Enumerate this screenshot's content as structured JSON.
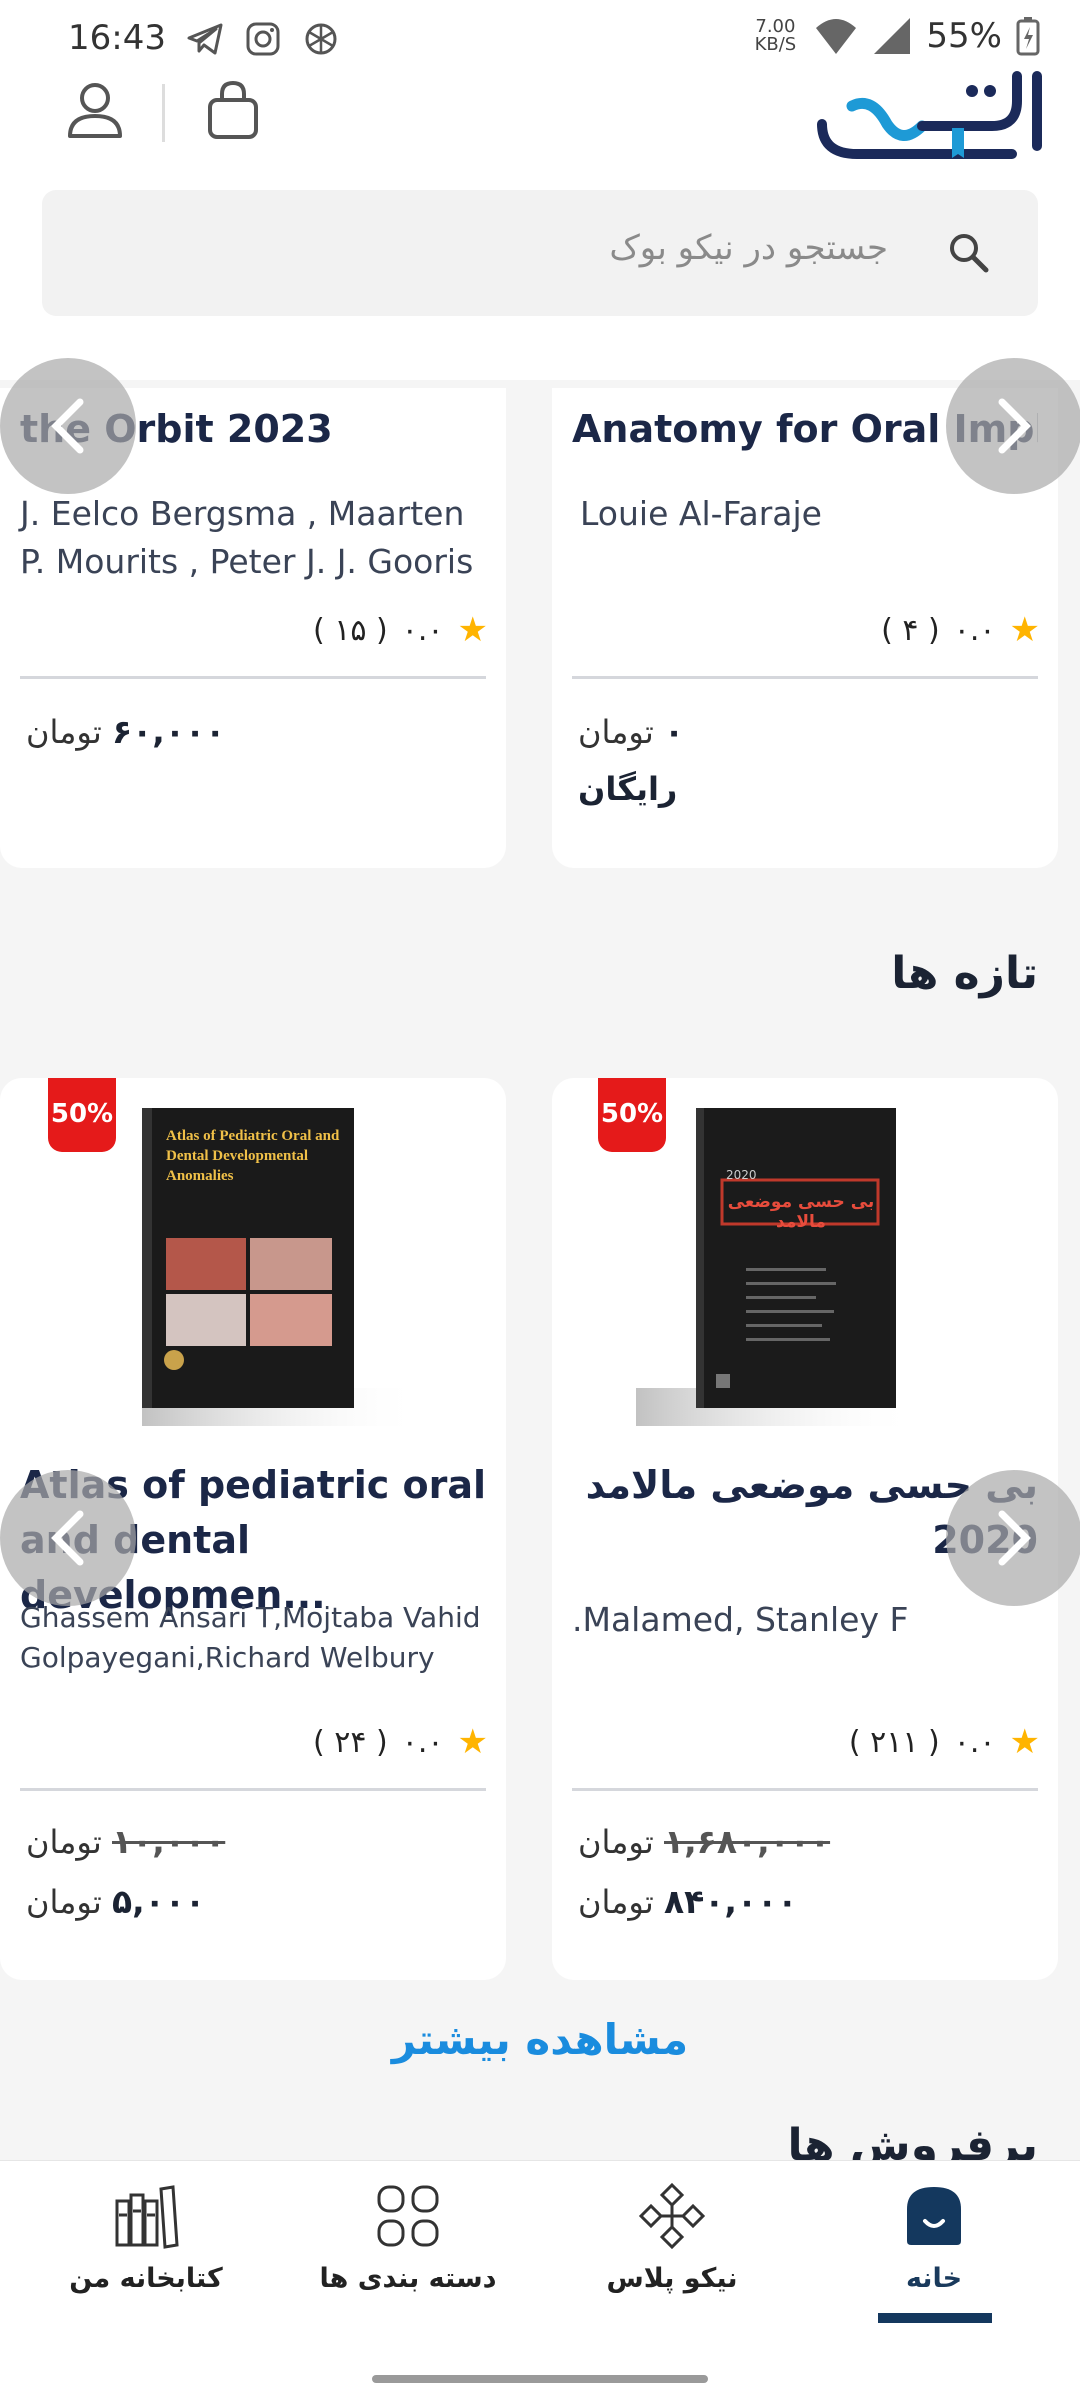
{
  "status_bar": {
    "time": "16:43",
    "net_speed": "7.00",
    "net_unit": "KB/S",
    "battery": "55%"
  },
  "search": {
    "placeholder": "جستجو در نیکو بوک"
  },
  "carousel_top": {
    "cards": [
      {
        "title": "the Orbit 2023",
        "author": "J. Eelco Bergsma , Maarten P. Mourits , Peter J. J. Gooris",
        "rating": "۰.۰",
        "count": "( ۱۵ )",
        "price_amount": "۶۰,۰۰۰",
        "currency": "تومان"
      },
      {
        "title": "Anatomy for Oral Impla..",
        "author": "Louie Al-Faraje",
        "rating": "۰.۰",
        "count": "( ۴ )",
        "price_amount": "۰",
        "currency": "تومان",
        "free_label": "رایگان"
      }
    ]
  },
  "new_section": {
    "title": "تازه ها",
    "cards": [
      {
        "discount": "50%",
        "cover_title": "Atlas of Pediatric Oral and Dental Developmental Anomalies",
        "title": "Atlas of pediatric oral and dental developmen...",
        "author": "Ghassem Ansari T,Mojtaba Vahid Golpayegani,Richard Welbury",
        "rating": "۰.۰",
        "count": "( ۲۴ )",
        "old_price": "۱۰,۰۰۰",
        "new_price": "۵,۰۰۰",
        "currency": "تومان"
      },
      {
        "discount": "50%",
        "cover_title": "بی حسی موضعی مالامد",
        "cover_year": "2020",
        "title": "بی حسی موضعی مالامد 2020",
        "author": ".Malamed, Stanley F",
        "rating": "۰.۰",
        "count": "( ۲۱۱ )",
        "old_price": "۱,۶۸۰,۰۰۰",
        "new_price": "۸۴۰,۰۰۰",
        "currency": "تومان"
      }
    ],
    "more_label": "مشاهده بیشتر"
  },
  "next_section_title": "پرفروش ها",
  "bottom_nav": {
    "items": [
      {
        "label": "کتابخانه من",
        "icon": "books-icon"
      },
      {
        "label": "دسته بندی ها",
        "icon": "categories-icon"
      },
      {
        "label": "نیکو پلاس",
        "icon": "plus-icon"
      },
      {
        "label": "خانه",
        "icon": "home-icon",
        "active": true
      }
    ]
  },
  "colors": {
    "accent": "#14385e",
    "link": "#1a8cde",
    "discount": "#e51a1a",
    "star": "#ffb400"
  }
}
